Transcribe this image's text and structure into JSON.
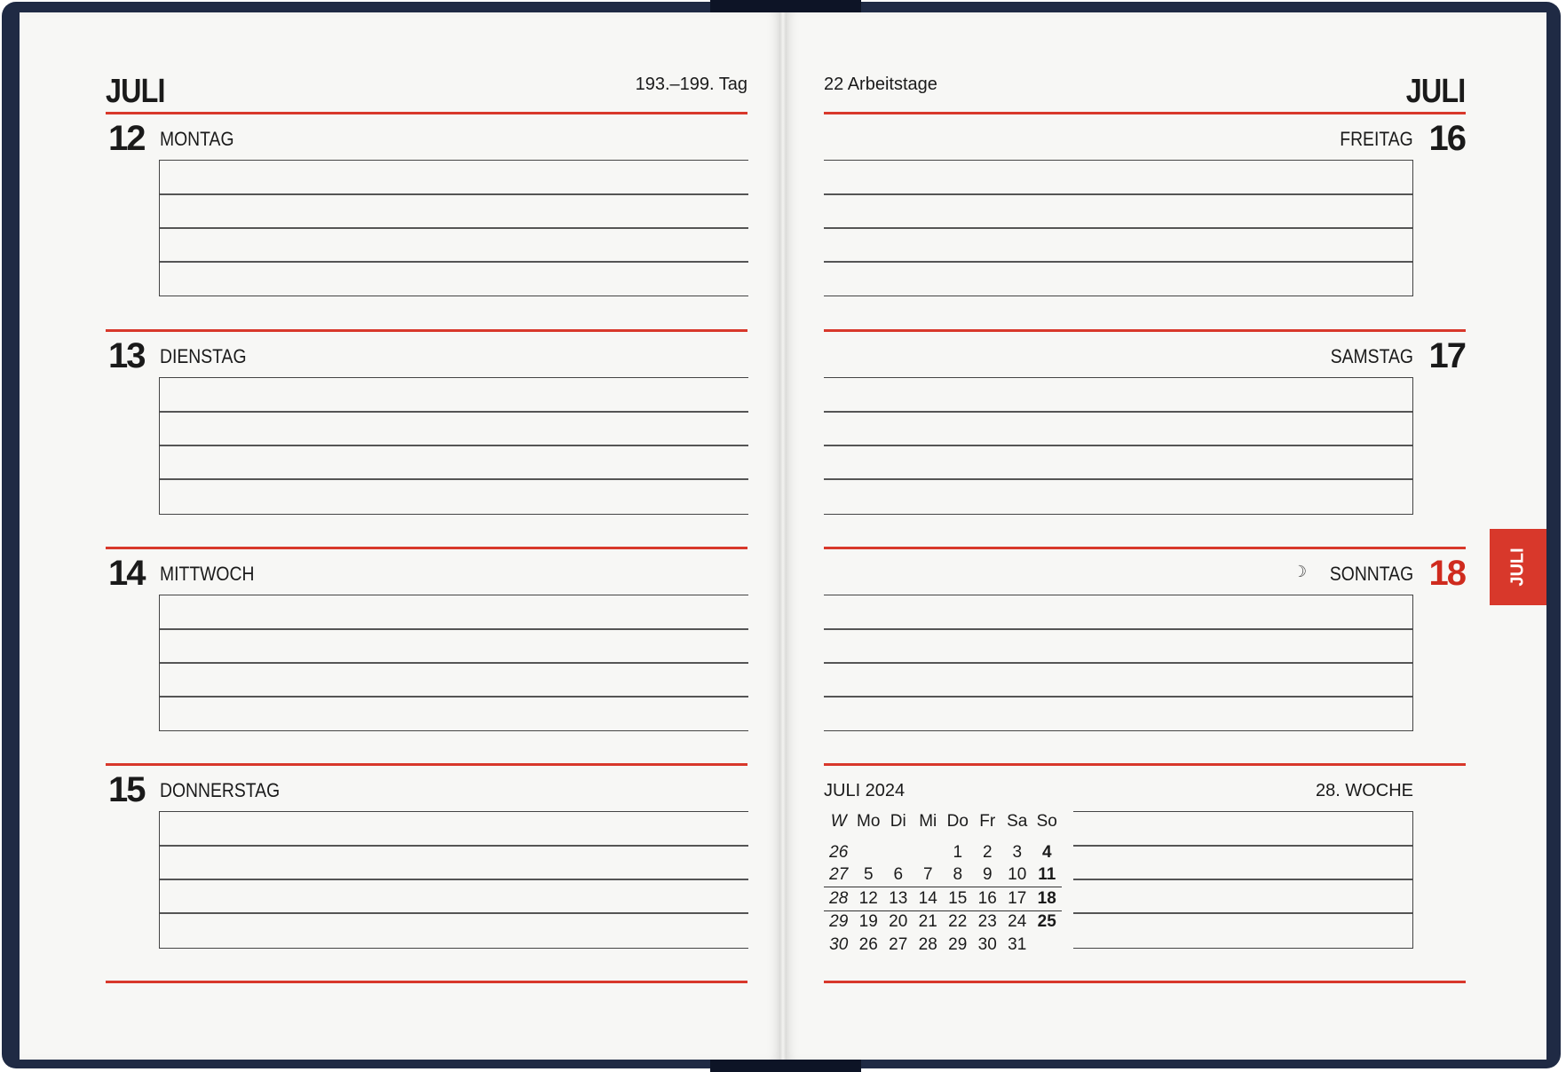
{
  "left_page": {
    "month": "JULI",
    "day_range": "193.–199. Tag",
    "days": [
      {
        "number": "12",
        "name": "MONTAG"
      },
      {
        "number": "13",
        "name": "DIENSTAG"
      },
      {
        "number": "14",
        "name": "MITTWOCH"
      },
      {
        "number": "15",
        "name": "DONNERSTAG"
      }
    ]
  },
  "right_page": {
    "month": "JULI",
    "working_days": "22 Arbeitstage",
    "days": [
      {
        "number": "16",
        "name": "FREITAG"
      },
      {
        "number": "17",
        "name": "SAMSTAG"
      },
      {
        "number": "18",
        "name": "SONNTAG",
        "moon_phase": "☽"
      }
    ],
    "mini_calendar": {
      "title": "JULI 2024",
      "week_label": "28. WOCHE",
      "headers": [
        "W",
        "Mo",
        "Di",
        "Mi",
        "Do",
        "Fr",
        "Sa",
        "So"
      ],
      "rows": [
        [
          "26",
          "",
          "",
          "",
          "1",
          "2",
          "3",
          "4"
        ],
        [
          "27",
          "5",
          "6",
          "7",
          "8",
          "9",
          "10",
          "11"
        ],
        [
          "28",
          "12",
          "13",
          "14",
          "15",
          "16",
          "17",
          "18"
        ],
        [
          "29",
          "19",
          "20",
          "21",
          "22",
          "23",
          "24",
          "25"
        ],
        [
          "30",
          "26",
          "27",
          "28",
          "29",
          "30",
          "31",
          ""
        ]
      ]
    },
    "side_tab": "JULI"
  },
  "colors": {
    "accent_red": "#d8382b",
    "cover_navy": "#1f2a44",
    "paper": "#f7f7f5"
  }
}
